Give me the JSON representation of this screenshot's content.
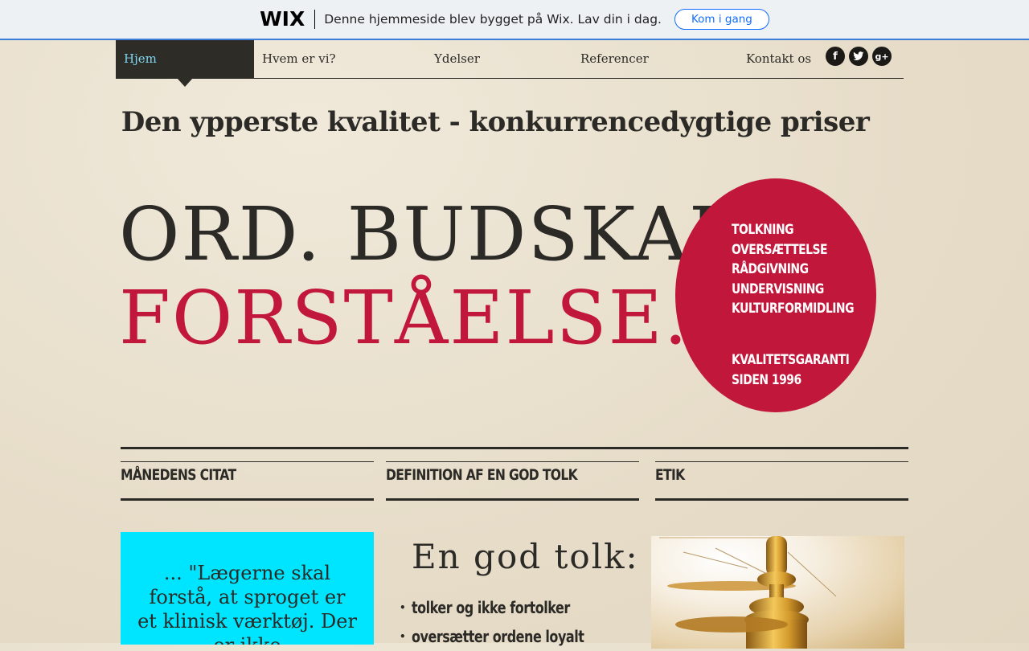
{
  "wix_banner": {
    "logo": "WIX",
    "message": "Denne hjemmeside blev bygget på Wix. Lav din i dag.",
    "cta": "Kom i gang"
  },
  "nav": {
    "items": [
      "Hjem",
      "Hvem er vi?",
      "Ydelser",
      "Referencer",
      "Kontakt os"
    ],
    "active": "Hjem",
    "social": [
      "facebook",
      "twitter",
      "google-plus"
    ]
  },
  "tagline": "Den ypperste kvalitet - konkurrencedygtige priser",
  "hero": {
    "line1": "ORD. BUDSKAB.",
    "line2": "FORSTÅELSE."
  },
  "services": {
    "items": [
      "TOLKNING",
      "OVERSÆTTELSE",
      "RÅDGIVNING",
      "UNDERVISNING",
      "KULTURFORMIDLING"
    ],
    "guarantee_line1": "KVALITETSGARANTI",
    "guarantee_line2": "SIDEN 1996"
  },
  "columns": {
    "col1": "MÅNEDENS CITAT",
    "col2": "DEFINITION AF EN GOD TOLK",
    "col3": "ETIK"
  },
  "quote": "... \"Lægerne skal forstå, at sproget er et klinisk værktøj. Der er ikke",
  "definition": {
    "title": "En god tolk:",
    "points": [
      "tolker og ikke fortolker",
      "oversætter ordene loyalt"
    ]
  },
  "colors": {
    "accent": "#c1173b",
    "nav_active_bg": "#2e2c27",
    "nav_active_text": "#7fd4f0",
    "quote_bg": "#00e5ff",
    "wix_blue": "#116dff"
  }
}
